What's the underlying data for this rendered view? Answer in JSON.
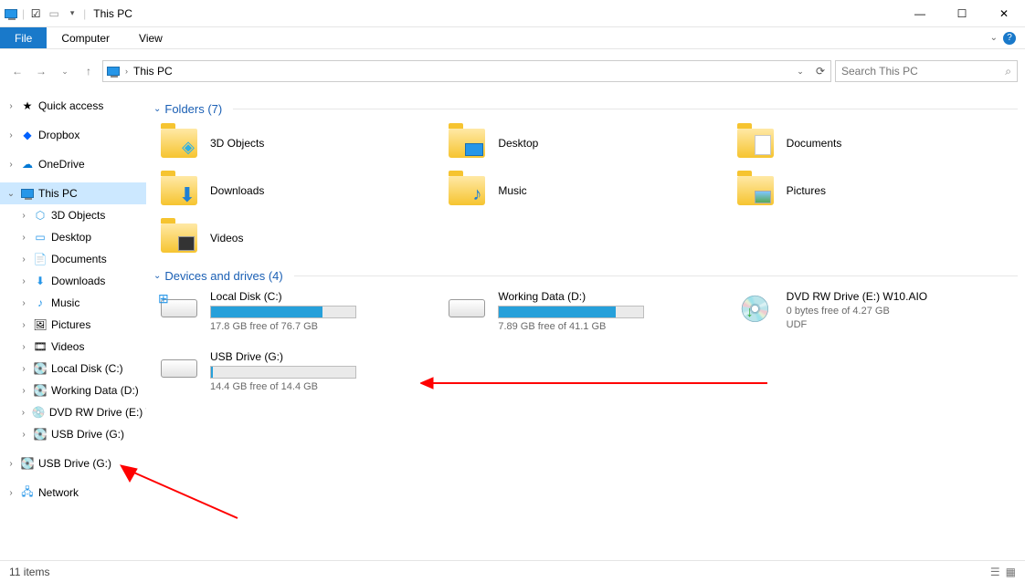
{
  "window": {
    "title": "This PC"
  },
  "ribbon": {
    "file": "File",
    "computer": "Computer",
    "view": "View"
  },
  "address": {
    "path": "This PC"
  },
  "search": {
    "placeholder": "Search This PC"
  },
  "sidebar": {
    "quick": "Quick access",
    "dropbox": "Dropbox",
    "onedrive": "OneDrive",
    "thispc": "This PC",
    "children": {
      "obj3d": "3D Objects",
      "desktop": "Desktop",
      "documents": "Documents",
      "downloads": "Downloads",
      "music": "Music",
      "pictures": "Pictures",
      "videos": "Videos",
      "localc": "Local Disk (C:)",
      "datad": "Working Data (D:)",
      "dvde": "DVD RW Drive (E:) W",
      "usbg1": "USB Drive (G:)"
    },
    "usbg2": "USB Drive (G:)",
    "network": "Network"
  },
  "groups": {
    "folders": "Folders (7)",
    "drives": "Devices and drives (4)"
  },
  "folders": {
    "obj3d": "3D Objects",
    "desktop": "Desktop",
    "documents": "Documents",
    "downloads": "Downloads",
    "music": "Music",
    "pictures": "Pictures",
    "videos": "Videos"
  },
  "drives": {
    "c": {
      "name": "Local Disk (C:)",
      "free": "17.8 GB free of 76.7 GB",
      "pct": 77
    },
    "d": {
      "name": "Working Data (D:)",
      "free": "7.89 GB free of 41.1 GB",
      "pct": 81
    },
    "e": {
      "name": "DVD RW Drive (E:) W10.AIO",
      "free": "0 bytes free of 4.27 GB",
      "fs": "UDF"
    },
    "g": {
      "name": "USB Drive (G:)",
      "free": "14.4 GB free of 14.4 GB",
      "pct": 1
    }
  },
  "status": {
    "items": "11 items"
  }
}
